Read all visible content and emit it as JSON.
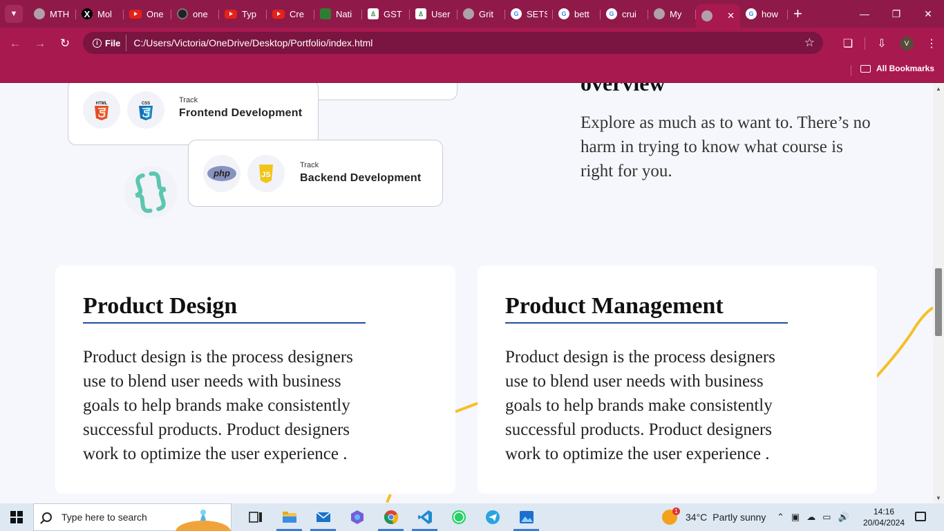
{
  "browser": {
    "tabs": [
      {
        "title": "MTH",
        "icon": "globe-icon"
      },
      {
        "title": "Mol",
        "icon": "x-logo-icon"
      },
      {
        "title": "One",
        "icon": "youtube-icon"
      },
      {
        "title": "one",
        "icon": "github-icon"
      },
      {
        "title": "Typ",
        "icon": "youtube-icon"
      },
      {
        "title": "Cre",
        "icon": "youtube-icon"
      },
      {
        "title": "Nati",
        "icon": "nat-icon"
      },
      {
        "title": "GST",
        "icon": "gst-icon"
      },
      {
        "title": "User",
        "icon": "gst-icon"
      },
      {
        "title": "Grit",
        "icon": "globe-icon"
      },
      {
        "title": "SETS",
        "icon": "google-icon"
      },
      {
        "title": "bett",
        "icon": "google-icon"
      },
      {
        "title": "crui",
        "icon": "google-icon"
      },
      {
        "title": "My",
        "icon": "globe-icon"
      },
      {
        "title": "",
        "icon": "globe-icon",
        "active": true
      },
      {
        "title": "how",
        "icon": "google-icon"
      }
    ],
    "address": {
      "scheme_label": "File",
      "url": "C:/Users/Victoria/OneDrive/Desktop/Portfolio/index.html"
    },
    "profile_initial": "V",
    "bookmarks_label": "All Bookmarks",
    "theme_color": "#a8194f"
  },
  "page": {
    "tracks": [
      {
        "label": "Track",
        "name": "Frontend Development",
        "icons": [
          "html5-icon",
          "css3-icon"
        ]
      },
      {
        "label": "Track",
        "name": "Backend Development",
        "icons": [
          "php-icon",
          "javascript-icon"
        ]
      }
    ],
    "html_badge": "HTML",
    "css_badge": "CSS",
    "php_badge": "php",
    "js_badge": "JS",
    "overview": {
      "heading": "overview",
      "text": "Explore as much as to want to. There’s no harm in trying to know what course is right for you."
    },
    "courses": [
      {
        "title": "Product Design",
        "text": "Product design is the process designers use to blend user needs with business goals to help brands make consistently successful products. Product designers work to optimize the user experience ."
      },
      {
        "title": "Product Management",
        "text": "Product design is the process designers use to blend user needs with business goals to help brands make consistently successful products. Product designers work to optimize the user experience ."
      }
    ],
    "accent_line_color": "#1f4f9c",
    "wave_color": "#f6bf26"
  },
  "taskbar": {
    "search_placeholder": "Type here to search",
    "apps": [
      "task-view-icon",
      "file-explorer-icon",
      "mail-icon",
      "copilot-icon",
      "chrome-icon",
      "vscode-icon",
      "whatsapp-icon",
      "telegram-icon",
      "photos-icon"
    ],
    "weather": {
      "temp": "34°C",
      "condition": "Partly sunny",
      "badge": "1"
    },
    "time": "14:16",
    "date": "20/04/2024"
  }
}
